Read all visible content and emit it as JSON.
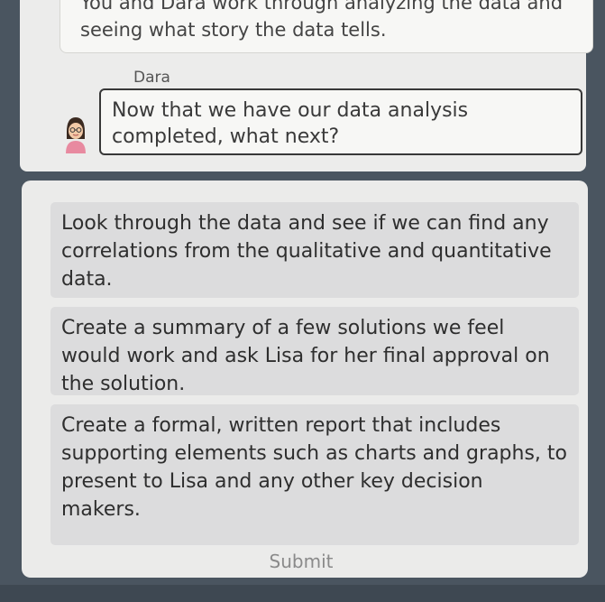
{
  "narration": {
    "text": "You and Dara work through analyzing the data and seeing what story the data tells."
  },
  "dialog": {
    "speaker": "Dara",
    "avatar_icon": "woman-avatar-icon",
    "text": "Now that we have our data analysis completed, what next?"
  },
  "choices": [
    {
      "text": "Look through the data and see if we can find any correlations from the qualitative and quantitative data."
    },
    {
      "text": "Create a summary of a few solutions we feel would work and ask Lisa for her final approval on the solution."
    },
    {
      "text": "Create a formal, written report that includes supporting elements such as charts and graphs, to present to Lisa and any other key decision makers."
    }
  ],
  "submit_label": "Submit",
  "colors": {
    "background": "#4a5560",
    "card": "#ebebea",
    "choice": "#dcdcdd",
    "bubble_border": "#383838"
  }
}
